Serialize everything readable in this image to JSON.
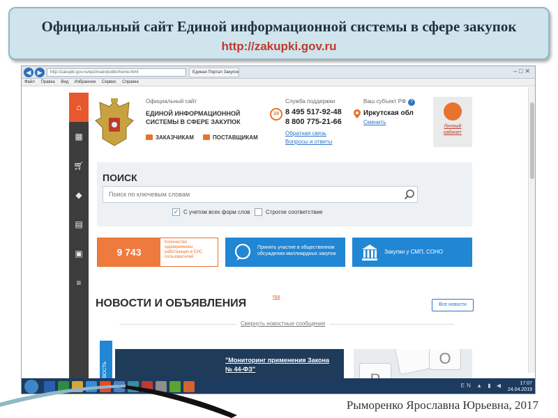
{
  "slide": {
    "title": "Официальный сайт Единой информационной системы в сфере закупок",
    "url": "http://zakupki.gov.ru",
    "author": "Рыморенко Ярославна Юрьевна, 2017"
  },
  "browser": {
    "address": "http://zakupki.gov.ru/epz/main/public/home.html",
    "tab_title": "Единая Портал Закупок",
    "menu": [
      "Файл",
      "Правка",
      "Вид",
      "Избранное",
      "Сервис",
      "Справка"
    ]
  },
  "header": {
    "site_small": "Официальный сайт",
    "site_name": "ЕДИНОЙ ИНФОРМАЦИОННОЙ СИСТЕМЫ В СФЕРЕ ЗАКУПОК",
    "customers_link": "ЗАКАЗЧИКАМ",
    "suppliers_link": "ПОСТАВЩИКАМ",
    "support_heading": "Служба поддержки",
    "support_badge": "24",
    "phone1": "8 495 517-92-48",
    "phone2": "8 800 775-21-66",
    "feedback_link": "Обратная связь",
    "faq_link": "Вопросы и ответы",
    "region_heading": "Ваш субъект РФ",
    "region_value": "Иркутская обл",
    "region_change": "Сменить",
    "cabinet_line1": "Личный",
    "cabinet_line2": "кабинет"
  },
  "search": {
    "heading": "ПОИСК",
    "placeholder": "Поиск по ключевым словам",
    "option1_label": "С учетом всех форм слов",
    "option1_checked": true,
    "option2_label": "Строгое соответствие",
    "option2_checked": false
  },
  "tiles": {
    "users_count": "9 743",
    "users_text": "Количество одновременно работающих в ЕИС пользователей",
    "discussion_text": "Принять участие в общественном обсуждении миллиардных закупок",
    "smp_text": "Закупки у СМП, СОНО"
  },
  "news": {
    "heading": "НОВОСТИ И ОБЪЯВЛЕНИЯ",
    "rss": "rss",
    "all_button": "Все новости",
    "collapse_link": "Свернуть новостные сообщения",
    "side_label": "НОВОСТЬ",
    "card_title": "\"Мониторинг применения Закона № 44-ФЗ\"",
    "key1": "P",
    "key2": "O"
  },
  "taskbar": {
    "lang": "EN",
    "time": "17:07",
    "date": "24.04.2019"
  },
  "colors": {
    "accent_orange": "#e8732d",
    "brand_blue": "#2186d4",
    "sidebar_dark": "#3d3d3d",
    "url_red": "#c0392b"
  },
  "icons": {
    "sidebar": [
      "home-icon",
      "calendar-icon",
      "cart-icon",
      "book-icon",
      "document-icon",
      "briefcase-icon",
      "list-icon"
    ]
  }
}
